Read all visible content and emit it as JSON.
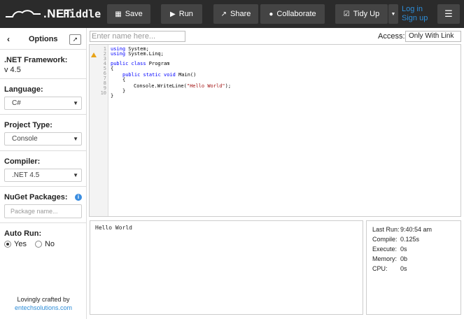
{
  "app": {
    "logo_text": ".NET",
    "logo_overlay": "Fiddle"
  },
  "toolbar": {
    "save_label": "Save",
    "run_label": "Run",
    "share_label": "Share",
    "collaborate_label": "Collaborate",
    "tidy_label": "Tidy Up",
    "login_label": "Log in",
    "signup_label": "Sign up"
  },
  "sidebar": {
    "title": "Options",
    "framework": {
      "label": ".NET Framework:",
      "value": "v 4.5"
    },
    "language": {
      "label": "Language:",
      "value": "C#"
    },
    "project_type": {
      "label": "Project Type:",
      "value": "Console"
    },
    "compiler": {
      "label": "Compiler:",
      "value": ".NET 4.5"
    },
    "nuget": {
      "label": "NuGet Packages:",
      "placeholder": "Package name..."
    },
    "auto_run": {
      "label": "Auto Run:",
      "yes": "Yes",
      "no": "No",
      "selected": "Yes"
    },
    "credit_line1": "Lovingly crafted by",
    "credit_link": "entechsolutions.com"
  },
  "editor": {
    "name_placeholder": "Enter name here...",
    "access_label": "Access:",
    "access_value": "Only With Link",
    "line_numbers": [
      "1",
      "2",
      "3",
      "4",
      "5",
      "6",
      "7",
      "8",
      "9",
      "10"
    ],
    "code": {
      "l1_kw": "using",
      "l1_rest": " System;",
      "l2_kw": "using",
      "l2_rest": " System.Linq;",
      "l4_kw": "public class",
      "l4_rest": " Program",
      "l5": "{",
      "l6_kw": "public static void",
      "l6_rest": " Main()",
      "l7": "{",
      "l8_pre": "Console.WriteLine(",
      "l8_str": "\"Hello World\"",
      "l8_post": ");",
      "l9": "}",
      "l10": "}"
    }
  },
  "output": {
    "text": "Hello World"
  },
  "stats": {
    "last_run_label": "Last Run:",
    "last_run_value": "9:40:54 am",
    "compile_label": "Compile:",
    "compile_value": "0.125s",
    "execute_label": "Execute:",
    "execute_value": "0s",
    "memory_label": "Memory:",
    "memory_value": "0b",
    "cpu_label": "CPU:",
    "cpu_value": "0s"
  }
}
